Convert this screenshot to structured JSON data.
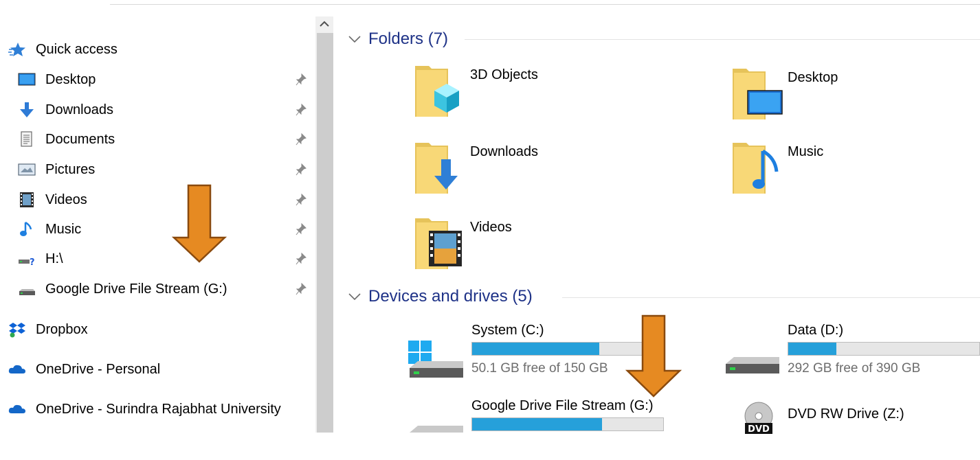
{
  "sidebar": {
    "items": [
      {
        "label": "Quick access",
        "icon": "star-icon",
        "pinned": false
      },
      {
        "label": "Desktop",
        "icon": "desktop-icon",
        "pinned": true
      },
      {
        "label": "Downloads",
        "icon": "download-arrow-icon",
        "pinned": true
      },
      {
        "label": "Documents",
        "icon": "document-icon",
        "pinned": true
      },
      {
        "label": "Pictures",
        "icon": "pictures-icon",
        "pinned": true
      },
      {
        "label": "Videos",
        "icon": "video-icon",
        "pinned": true
      },
      {
        "label": "Music",
        "icon": "music-note-icon",
        "pinned": true
      },
      {
        "label": "H:\\",
        "icon": "network-drive-icon",
        "pinned": true
      },
      {
        "label": "Google Drive File Stream (G:)",
        "icon": "drive-icon",
        "pinned": true
      },
      {
        "label": "Dropbox",
        "icon": "dropbox-icon",
        "pinned": false
      },
      {
        "label": "OneDrive - Personal",
        "icon": "cloud-icon",
        "pinned": false
      },
      {
        "label": "OneDrive - Surindra Rajabhat University",
        "icon": "cloud-icon",
        "pinned": false
      }
    ]
  },
  "folders_group": {
    "title": "Folders (7)",
    "items": [
      {
        "label": "3D Objects",
        "icon": "3d-objects-folder-icon"
      },
      {
        "label": "Desktop",
        "icon": "desktop-folder-icon"
      },
      {
        "label": "Downloads",
        "icon": "downloads-folder-icon"
      },
      {
        "label": "Music",
        "icon": "music-folder-icon"
      },
      {
        "label": "Videos",
        "icon": "videos-folder-icon"
      }
    ]
  },
  "drives_group": {
    "title": "Devices and drives (5)",
    "items": [
      {
        "name": "System (C:)",
        "free": "50.1 GB free of 150 GB",
        "used_fraction": 0.666,
        "icon": "windows-drive-icon"
      },
      {
        "name": "Data (D:)",
        "free": "292 GB free of 390 GB",
        "used_fraction": 0.251,
        "icon": "hard-drive-icon"
      },
      {
        "name": "Google Drive File Stream (G:)",
        "used_fraction": 0.68,
        "icon": "hard-drive-icon"
      },
      {
        "name": "DVD RW Drive (Z:)",
        "icon": "dvd-drive-icon",
        "badge": "DVD"
      }
    ]
  },
  "colors": {
    "accent_title": "#1e3287",
    "bar_fill": "#26a0da",
    "annotation_arrow": "#e68a22"
  }
}
